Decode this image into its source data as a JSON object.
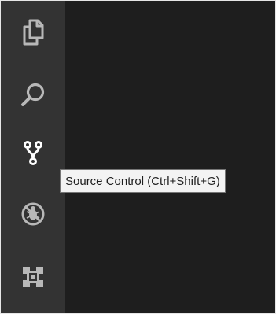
{
  "activity_bar": {
    "items": [
      {
        "name": "explorer",
        "icon": "files-icon",
        "active": false
      },
      {
        "name": "search",
        "icon": "search-icon",
        "active": false
      },
      {
        "name": "source-control",
        "icon": "source-control-icon",
        "active": true
      },
      {
        "name": "debug",
        "icon": "debug-icon",
        "active": false
      },
      {
        "name": "extensions",
        "icon": "extensions-icon",
        "active": false
      }
    ]
  },
  "tooltip": {
    "text": "Source Control (Ctrl+Shift+G)"
  },
  "colors": {
    "activity_bar_bg": "#333333",
    "editor_bg": "#1e1e1e",
    "icon_inactive": "#b8b8b8",
    "icon_active": "#ffffff",
    "tooltip_bg": "#f3f3f3",
    "tooltip_border": "#767676"
  }
}
